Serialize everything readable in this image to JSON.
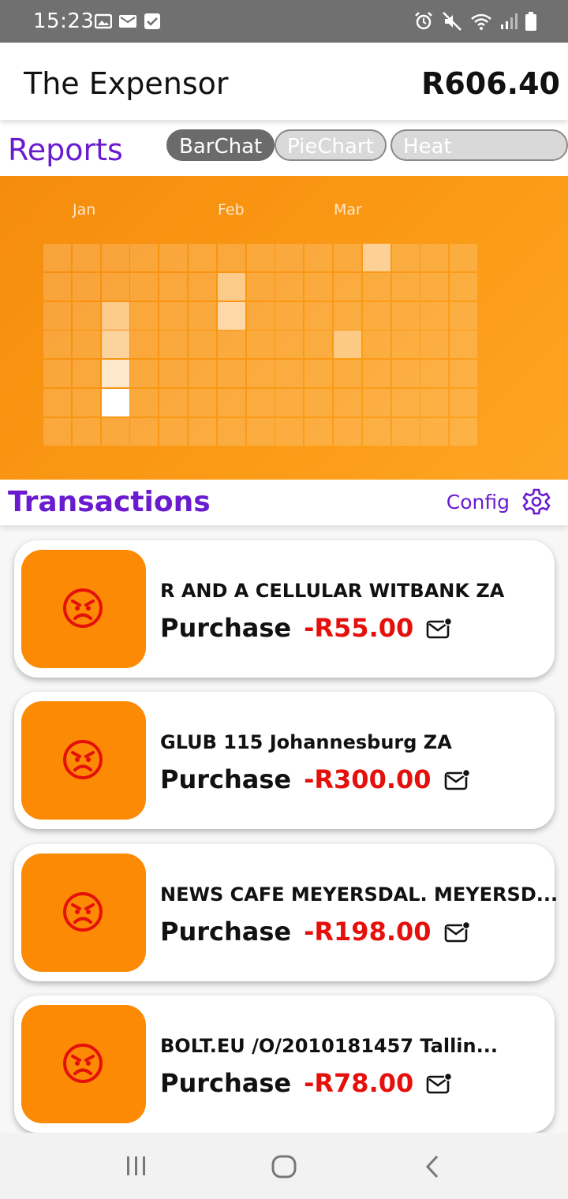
{
  "status_bar": {
    "time": "15:23"
  },
  "app": {
    "title": "The Expensor",
    "total": "R606.40"
  },
  "reports": {
    "label": "Reports",
    "tabs": [
      {
        "label": "BarChat",
        "active": true
      },
      {
        "label": "PieChart",
        "active": false
      },
      {
        "label": "Heat Map(new)",
        "active": false
      }
    ]
  },
  "heatmap": {
    "months": [
      "Jan",
      "Feb",
      "Mar"
    ],
    "columns": 15,
    "rows": 7,
    "highlights": [
      {
        "col": 11,
        "row": 0,
        "intensity": 0.45
      },
      {
        "col": 6,
        "row": 1,
        "intensity": 0.4
      },
      {
        "col": 2,
        "row": 2,
        "intensity": 0.4
      },
      {
        "col": 6,
        "row": 2,
        "intensity": 0.55
      },
      {
        "col": 2,
        "row": 3,
        "intensity": 0.5
      },
      {
        "col": 10,
        "row": 3,
        "intensity": 0.35
      },
      {
        "col": 2,
        "row": 4,
        "intensity": 0.75
      },
      {
        "col": 2,
        "row": 5,
        "intensity": 1.0
      }
    ],
    "colors": {
      "base": "#f68c0c",
      "cell": "rgba(255,255,255,0.18)",
      "highlight": "#ffffff"
    }
  },
  "transactions": {
    "label": "Transactions",
    "config_label": "Config",
    "items": [
      {
        "merchant": "R AND A CELLULAR WITBANK ZA",
        "type": "Purchase",
        "amount": "-R55.00"
      },
      {
        "merchant": "GLUB 115 Johannesburg ZA",
        "type": "Purchase",
        "amount": "-R300.00"
      },
      {
        "merchant": "NEWS CAFE MEYERSDAL. MEYERSD...",
        "type": "Purchase",
        "amount": "-R198.00"
      },
      {
        "merchant": "BOLT.EU /O/2010181457 Tallin...",
        "type": "Purchase",
        "amount": "-R78.00"
      }
    ]
  },
  "icons": {
    "status_left": [
      "image-icon",
      "mail-notification-icon",
      "check-notification-icon"
    ],
    "status_right": [
      "alarm-icon",
      "mute-icon",
      "wifi-icon",
      "signal-icon",
      "battery-icon"
    ],
    "thumb": "angry-face-icon",
    "message": "sms-icon",
    "settings": "gear-icon",
    "nav": [
      "recents-icon",
      "home-icon",
      "back-icon"
    ]
  },
  "accent_colors": {
    "purple": "#6a1bcf",
    "orange": "#fd8a04",
    "red": "#e4100c"
  }
}
